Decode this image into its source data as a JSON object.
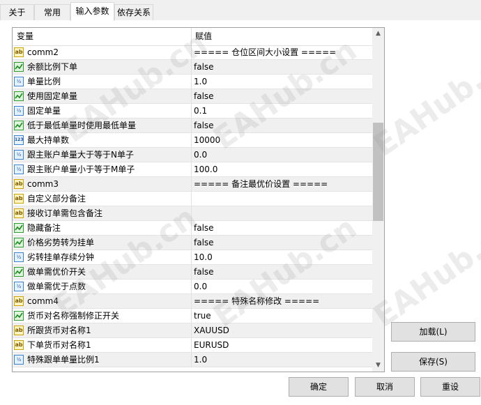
{
  "tabs": [
    {
      "label": "关于",
      "active": false
    },
    {
      "label": "常用",
      "active": false
    },
    {
      "label": "输入参数",
      "active": true
    },
    {
      "label": "依存关系",
      "active": false
    }
  ],
  "grid": {
    "header": {
      "variable": "变量",
      "value": "赋值"
    },
    "rows": [
      {
        "icon": "string-icon",
        "name": "comm2",
        "value": "===== 仓位区间大小设置 ====="
      },
      {
        "icon": "bool-icon",
        "name": "余额比例下单",
        "value": "false"
      },
      {
        "icon": "double-icon",
        "name": "单量比例",
        "value": "1.0"
      },
      {
        "icon": "bool-icon",
        "name": "使用固定单量",
        "value": "false"
      },
      {
        "icon": "double-icon",
        "name": "固定单量",
        "value": "0.1"
      },
      {
        "icon": "bool-icon",
        "name": "低于最低单量时使用最低单量",
        "value": "false"
      },
      {
        "icon": "int-icon",
        "name": "最大持单数",
        "value": "10000"
      },
      {
        "icon": "double-icon",
        "name": "跟主账户单量大于等于N单子",
        "value": "0.0"
      },
      {
        "icon": "double-icon",
        "name": "跟主账户单量小于等于M单子",
        "value": "100.0"
      },
      {
        "icon": "string-icon",
        "name": "comm3",
        "value": "===== 备注最优价设置 ====="
      },
      {
        "icon": "string-icon",
        "name": "自定义部分备注",
        "value": ""
      },
      {
        "icon": "string-icon",
        "name": "接收订单需包含备注",
        "value": ""
      },
      {
        "icon": "bool-icon",
        "name": "隐藏备注",
        "value": "false"
      },
      {
        "icon": "bool-icon",
        "name": "价格劣势转为挂单",
        "value": "false"
      },
      {
        "icon": "double-icon",
        "name": "劣转挂单存续分钟",
        "value": "10.0"
      },
      {
        "icon": "bool-icon",
        "name": "做单需优价开关",
        "value": "false"
      },
      {
        "icon": "double-icon",
        "name": "做单需优于点数",
        "value": "0.0"
      },
      {
        "icon": "string-icon",
        "name": "comm4",
        "value": "===== 特殊名称修改 ====="
      },
      {
        "icon": "bool-icon",
        "name": "货币对名称强制修正开关",
        "value": "true"
      },
      {
        "icon": "string-icon",
        "name": "所跟货币对名称1",
        "value": "XAUUSD"
      },
      {
        "icon": "string-icon",
        "name": "下单货币对名称1",
        "value": "EURUSD"
      },
      {
        "icon": "double-icon",
        "name": "特殊跟单单量比例1",
        "value": "1.0"
      }
    ]
  },
  "buttons": {
    "load": "加载(L)",
    "save": "保存(S)",
    "ok": "确定",
    "cancel": "取消",
    "reset": "重设"
  },
  "watermark": "EAHub.cn"
}
